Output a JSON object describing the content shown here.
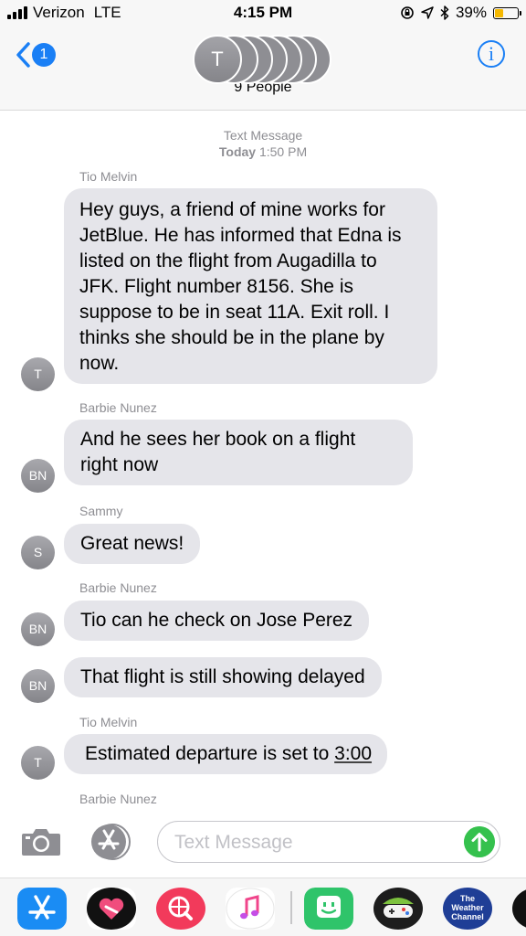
{
  "status_bar": {
    "carrier": "Verizon",
    "network": "LTE",
    "time": "4:15 PM",
    "battery_text": "39%",
    "battery_level": 0.39,
    "icons": [
      "signal-icon",
      "lock-rotation-icon",
      "location-icon",
      "bluetooth-icon",
      "battery-icon"
    ]
  },
  "header": {
    "back_badge": "1",
    "avatar_initial": "T",
    "group_label": "9 People",
    "info_label": "i"
  },
  "conversation": {
    "service": "Text Message",
    "date_day": "Today",
    "date_time": "1:50 PM"
  },
  "messages": [
    {
      "sender": "Tio Melvin",
      "initials": "T",
      "text": "Hey guys,  a friend of mine works for JetBlue. He has informed that Edna is listed on the flight from Augadilla to JFK. Flight number 8156. She is suppose to be in seat 11A. Exit roll. I thinks she should be in the plane by now."
    },
    {
      "sender": "Barbie Nunez",
      "initials": "BN",
      "text": "And he sees her book on a flight right now"
    },
    {
      "sender": "Sammy",
      "initials": "S",
      "text": "Great news!"
    },
    {
      "sender": "Barbie Nunez",
      "initials": "BN",
      "text": "Tio can he check on Jose Perez"
    },
    {
      "sender": "",
      "initials": "BN",
      "text": "That flight is still showing delayed"
    },
    {
      "sender": "Tio Melvin",
      "initials": "T",
      "text_before": "Estimated departure is set to ",
      "text_link": "3:00"
    },
    {
      "sender": "Barbie Nunez"
    }
  ],
  "compose": {
    "placeholder": "Text Message",
    "icons": [
      "camera-icon",
      "app-store-icon",
      "send-arrow-icon"
    ]
  },
  "app_drawer": {
    "apps": [
      {
        "name": "app-store-app",
        "color": "#1a8cf4"
      },
      {
        "name": "heart-sticker-app",
        "color": "#111111"
      },
      {
        "name": "search-images-app",
        "color": "#f23a5b"
      },
      {
        "name": "music-app",
        "color": "#ffffff"
      },
      {
        "name": "sticker-face-app",
        "color": "#2fc46a"
      },
      {
        "name": "game-app",
        "color": "#1d1d1d"
      },
      {
        "name": "weather-channel-app",
        "color": "#1f3e96",
        "label_1": "The",
        "label_2": "Weather",
        "label_3": "Channel"
      },
      {
        "name": "partial-app",
        "color": "#111111"
      }
    ]
  }
}
